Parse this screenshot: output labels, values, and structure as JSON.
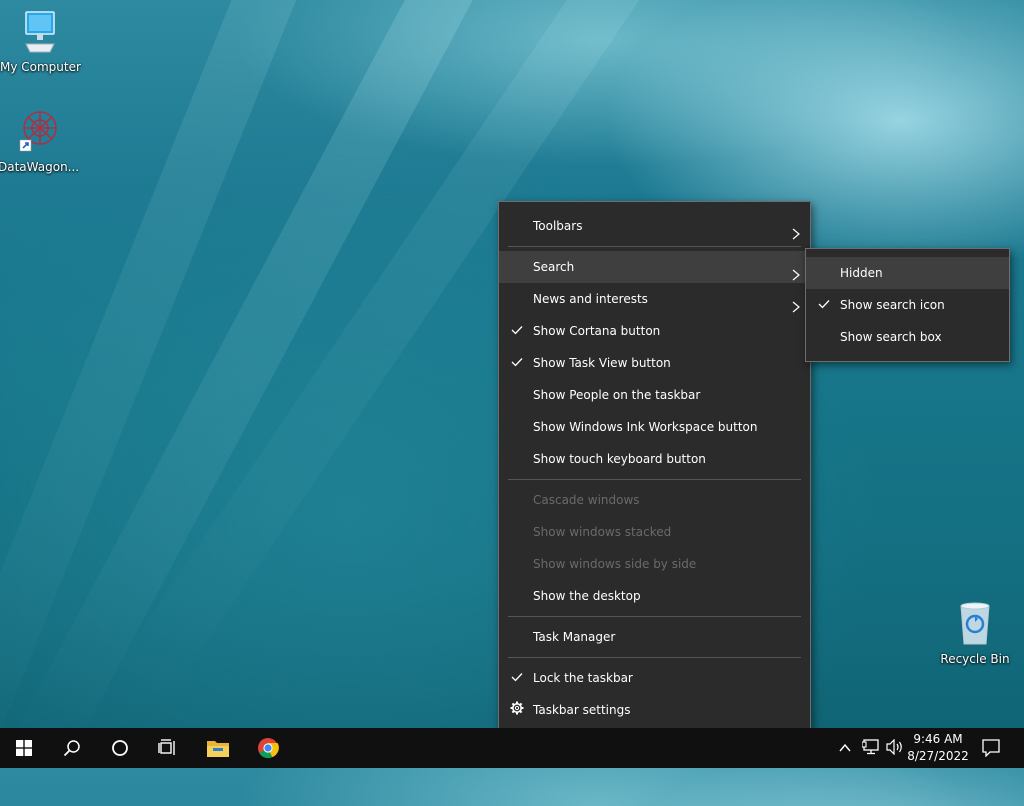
{
  "desktop": {
    "icons": [
      {
        "label": "My Computer"
      },
      {
        "label": "DataWagon..."
      },
      {
        "label": "Recycle Bin"
      }
    ]
  },
  "context_menu": {
    "items": [
      {
        "label": "Toolbars",
        "submenu": true
      },
      {
        "label": "Search",
        "submenu": true,
        "highlighted": true
      },
      {
        "label": "News and interests",
        "submenu": true
      },
      {
        "label": "Show Cortana button",
        "checked": true
      },
      {
        "label": "Show Task View button",
        "checked": true
      },
      {
        "label": "Show People on the taskbar"
      },
      {
        "label": "Show Windows Ink Workspace button"
      },
      {
        "label": "Show touch keyboard button"
      },
      {
        "label": "Cascade windows",
        "disabled": true
      },
      {
        "label": "Show windows stacked",
        "disabled": true
      },
      {
        "label": "Show windows side by side",
        "disabled": true
      },
      {
        "label": "Show the desktop"
      },
      {
        "label": "Task Manager"
      },
      {
        "label": "Lock the taskbar",
        "checked": true
      },
      {
        "label": "Taskbar settings",
        "icon": "gear-icon"
      }
    ]
  },
  "search_submenu": {
    "items": [
      {
        "label": "Hidden",
        "highlighted": true
      },
      {
        "label": "Show search icon",
        "checked": true
      },
      {
        "label": "Show search box"
      }
    ]
  },
  "taskbar": {
    "buttons": [
      "start-icon",
      "search-icon",
      "cortana-icon",
      "task-view-icon",
      "file-explorer-icon",
      "chrome-icon"
    ],
    "tray": [
      "chevron-up-icon",
      "network-icon",
      "volume-icon"
    ],
    "time": "9:46 AM",
    "date": "8/27/2022",
    "notification_icon": "notification-icon"
  },
  "colors": {
    "menu_bg": "#2b2b2b",
    "menu_highlight": "#3f3f3f",
    "taskbar_bg": "#101010",
    "disabled_text": "#6a6a6a"
  }
}
